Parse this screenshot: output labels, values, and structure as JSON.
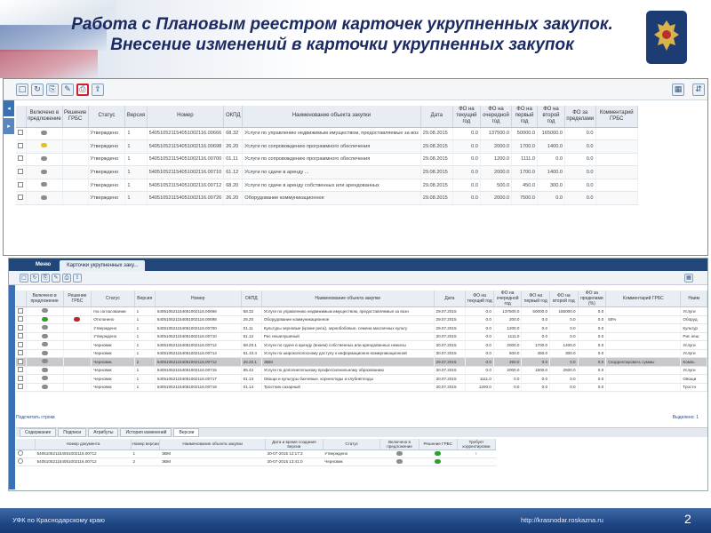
{
  "slide": {
    "title_line1": "Работа с Плановым реестром карточек укрупненных закупок.",
    "title_line2": "Внесение изменений в карточки укрупненных закупок",
    "footer_left": "УФК по Краснодарскому краю",
    "footer_url": "http://krasnodar.roskazna.ru",
    "page_number": "2"
  },
  "top_grid": {
    "headers": [
      "",
      "Включено в предложение",
      "Решение ГРБС",
      "Статус",
      "Версия",
      "Номер",
      "ОКПД",
      "Наименование объекта закупки",
      "Дата",
      "ФО на текущий год",
      "ФО на очередной год",
      "ФО на первый год",
      "ФО на второй год",
      "ФО за пределами",
      "Комментарий ГРБС"
    ],
    "rows": [
      [
        "",
        "",
        "",
        "Утверждено",
        "1",
        "540510521154051002116.00666",
        "68.32",
        "Услуги по управлению недвижимым имуществом, предоставляемые за воз",
        "29.08.2015",
        "0.0",
        "137500.0",
        "50000.0",
        "165000.0",
        "0.0",
        ""
      ],
      [
        "",
        "",
        "",
        "Утверждено",
        "1",
        "540510521154051002116.00698",
        "26.20",
        "Услуги по сопровождению программного обеспечения",
        "29.08.2015",
        "0.0",
        "2000.0",
        "1700.0",
        "1400.0",
        "0.0",
        ""
      ],
      [
        "",
        "",
        "",
        "Утверждено",
        "1",
        "540510521154051002116.00700",
        "01.11",
        "Услуги по сопровождению программного обеспечения",
        "29.08.2015",
        "0.0",
        "1200.0",
        "1111.0",
        "0.0",
        "0.0",
        ""
      ],
      [
        "",
        "",
        "",
        "Утверждено",
        "1",
        "540510521154051002116.00710",
        "61.12",
        "Услуги по сдаче в аренду ...",
        "29.08.2015",
        "0.0",
        "2000.0",
        "1700.0",
        "1400.0",
        "0.0",
        ""
      ],
      [
        "",
        "",
        "",
        "Утверждено",
        "1",
        "540510521154051002116.00712",
        "68.20",
        "Услуги по сдаче в аренду собственных или арендованных",
        "29.08.2015",
        "0.0",
        "500.0",
        "450.0",
        "300.0",
        "0.0",
        ""
      ],
      [
        "",
        "",
        "",
        "Утверждено",
        "1",
        "540510521154051002116.00726",
        "26.20",
        "Оборудование коммуникационное",
        "29.08.2015",
        "0.0",
        "2000.0",
        "7500.0",
        "0.0",
        "0.0",
        ""
      ]
    ],
    "dots": [
      "gray",
      "yellow",
      "gray",
      "gray",
      "gray",
      "gray"
    ]
  },
  "bottom_window": {
    "menu_label": "Меню",
    "tab_label": "Карточки укрупненных заку...",
    "headers": [
      "",
      "Включено в предложение",
      "Решение ГРБС",
      "Статус",
      "Версия",
      "Номер",
      "ОКПД",
      "Наименование объекта закупки",
      "Дата",
      "ФО на текущий год",
      "ФО на очередной год",
      "ФО на первый год",
      "ФО на второй год",
      "ФО за пределами (%)",
      "Комментарий ГРБС",
      "Наим"
    ],
    "rows": [
      [
        "",
        "",
        "",
        "На согласовании",
        "1",
        "540510521154051002116.00666",
        "68.32",
        "Услуги по управлению недвижимым имуществом, предоставляемые за возн",
        "29.07.2015",
        "0.0",
        "137500.0",
        "50000.0",
        "165000.0",
        "0.0",
        "",
        "Услуги"
      ],
      [
        "",
        "",
        "",
        "Отклонено",
        "1",
        "540510521154051002116.00698",
        "26.20",
        "Оборудование коммуникационное",
        "29.07.2015",
        "0.0",
        "200.0",
        "0.0",
        "0.0",
        "0.0",
        "50%",
        "Оборуд"
      ],
      [
        "",
        "",
        "",
        "Утверждено",
        "1",
        "540510521154051002116.00700",
        "01.11",
        "Культуры зерновые (кроме риса), зернобобовые, семена масличных культу",
        "29.07.2015",
        "0.0",
        "1200.0",
        "0.0",
        "0.0",
        "0.0",
        "",
        "Культур"
      ],
      [
        "",
        "",
        "",
        "Утверждено",
        "1",
        "540510521154051002116.00710",
        "61.12",
        "Рис нешелушеный",
        "30.07.2015",
        "0.0",
        "1111.0",
        "0.0",
        "0.0",
        "0.0",
        "",
        "Рис неш"
      ],
      [
        "",
        "",
        "",
        "Черновик",
        "1",
        "540510521154051002116.00712",
        "68.20.1",
        "Услуги по сдаче в аренду (внаем) собственных или арендованных нежилы",
        "30.07.2015",
        "0.0",
        "2000.0",
        "1700.0",
        "1400.0",
        "0.0",
        "",
        "Услуги"
      ],
      [
        "",
        "",
        "",
        "Черновик",
        "1",
        "540510521154051002116.00714",
        "61.10.4",
        "Услуги по широкополосному доступу к информационно-коммуникационной",
        "30.07.2015",
        "0.0",
        "500.0",
        "450.0",
        "300.0",
        "0.0",
        "",
        "Услуги"
      ],
      [
        "",
        "",
        "",
        "Черновик",
        "2",
        "540510521154051002116.00712",
        "26.20.1",
        "ЭВМ",
        "29.07.2015",
        "0.0",
        "250.0",
        "0.0",
        "0.0",
        "0.0",
        "Скорректировать суммы",
        "Компь"
      ],
      [
        "",
        "",
        "",
        "Черновик",
        "1",
        "540510521154051002116.00715",
        "85.42",
        "Услуги по дополнительному профессиональному образованию",
        "30.07.2015",
        "0.0",
        "2000.0",
        "1500.0",
        "2500.0",
        "0.0",
        "",
        "Услуги"
      ],
      [
        "",
        "",
        "",
        "Черновик",
        "1",
        "540510521154051002116.00717",
        "01.13",
        "Овощи и культуры бахчевые, корнеплоды и клубнеплоды",
        "30.07.2015",
        "1111.0",
        "0.0",
        "0.0",
        "0.0",
        "0.0",
        "",
        "Овощи"
      ],
      [
        "",
        "",
        "",
        "Черновик",
        "1",
        "540510521154051002116.00718",
        "01.14",
        "Тростник сахарный",
        "30.07.2015",
        "1200.0",
        "0.0",
        "0.0",
        "0.0",
        "0.0",
        "",
        "Тростн"
      ]
    ],
    "dots": [
      [
        "gray",
        ""
      ],
      [
        "green",
        "red"
      ],
      [
        "gray",
        ""
      ],
      [
        "gray",
        ""
      ],
      [
        "gray",
        ""
      ],
      [
        "gray",
        ""
      ],
      [
        "gray",
        ""
      ],
      [
        "gray",
        ""
      ],
      [
        "gray",
        ""
      ],
      [
        "gray",
        ""
      ]
    ],
    "selected_row": 6,
    "status_left": "Подсчитать строки",
    "status_right": "Выделено: 1",
    "detail_tabs": [
      "Содержание",
      "Подписи",
      "Атрибуты",
      "История изменений",
      "Версии"
    ],
    "detail_headers": [
      "",
      "Номер документа",
      "Номер версии",
      "Наименование объекта закупки",
      "Дата и время создания версии",
      "Статус",
      "Включено в предложение",
      "Решение ГРБС",
      "Требует корректировки"
    ],
    "detail_rows": [
      [
        "",
        "540510521154051002116.00712",
        "1",
        "ЭВМ",
        "30-07-2015 12:17:3",
        "Утверждено",
        "",
        "",
        ""
      ],
      [
        "",
        "540510521154051002116.00712",
        "2",
        "ЭВМ",
        "30-07-2015 13:41:0",
        "Черновик",
        "",
        "",
        ""
      ]
    ]
  },
  "colors": {
    "title": "#1b2a60",
    "footer": "#1f4785",
    "accent": "#3a70b4",
    "highlight": "#d3202c"
  }
}
